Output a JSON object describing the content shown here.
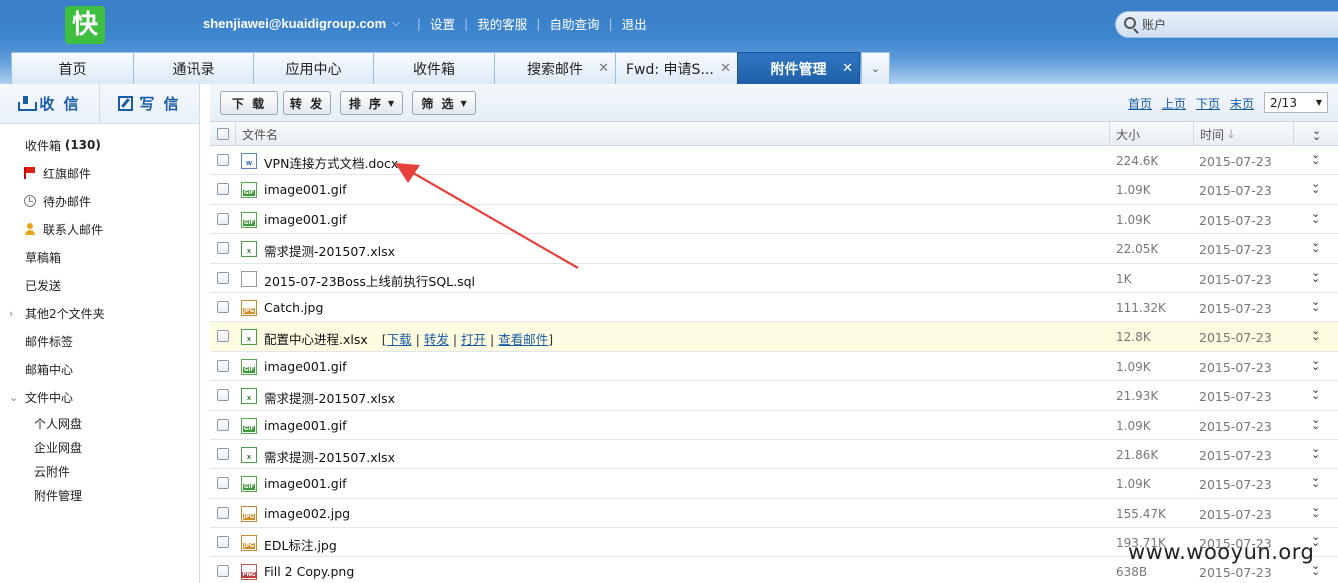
{
  "header": {
    "logo_text": "快",
    "user_email": "shenjiawei@kuaidigroup.com",
    "links": [
      "设置",
      "我的客服",
      "自助查询",
      "退出"
    ],
    "search_placeholder": "账户"
  },
  "tabs": [
    {
      "label": "首页",
      "closable": false
    },
    {
      "label": "通讯录",
      "closable": false
    },
    {
      "label": "应用中心",
      "closable": false
    },
    {
      "label": "收件箱",
      "closable": false
    },
    {
      "label": "搜索邮件",
      "closable": true
    },
    {
      "label": "Fwd: 申请S...",
      "closable": true
    },
    {
      "label": "附件管理",
      "closable": true,
      "active": true
    }
  ],
  "sidebar": {
    "receive_label": "收 信",
    "write_label": "写 信",
    "inbox_label": "收件箱",
    "inbox_count": "(130)",
    "items": [
      "红旗邮件",
      "待办邮件",
      "联系人邮件",
      "草稿箱",
      "已发送",
      "其他2个文件夹",
      "邮件标签",
      "邮箱中心",
      "文件中心"
    ],
    "file_center_items": [
      "个人网盘",
      "企业网盘",
      "云附件",
      "附件管理"
    ]
  },
  "toolbar": {
    "download": "下 载",
    "forward": "转 发",
    "sort": "排 序",
    "filter": "筛 选",
    "pager": {
      "first": "首页",
      "prev": "上页",
      "next": "下页",
      "last": "末页",
      "current": "2/13"
    }
  },
  "table": {
    "columns": {
      "name": "文件名",
      "size": "大小",
      "time": "时间"
    },
    "rows": [
      {
        "type": "word",
        "name": "VPN连接方式文档.docx",
        "size": "224.6K",
        "date": "2015-07-23"
      },
      {
        "type": "gif",
        "name": "image001.gif",
        "size": "1.09K",
        "date": "2015-07-23"
      },
      {
        "type": "gif",
        "name": "image001.gif",
        "size": "1.09K",
        "date": "2015-07-23"
      },
      {
        "type": "xlsx",
        "name": "需求提测-201507.xlsx",
        "size": "22.05K",
        "date": "2015-07-23"
      },
      {
        "type": "sql",
        "name": "2015-07-23Boss上线前执行SQL.sql",
        "size": "1K",
        "date": "2015-07-23"
      },
      {
        "type": "jpg",
        "name": "Catch.jpg",
        "size": "111.32K",
        "date": "2015-07-23"
      },
      {
        "type": "xlsx",
        "name": "配置中心进程.xlsx",
        "size": "12.8K",
        "date": "2015-07-23",
        "hover": true
      },
      {
        "type": "gif",
        "name": "image001.gif",
        "size": "1.09K",
        "date": "2015-07-23"
      },
      {
        "type": "xlsx",
        "name": "需求提测-201507.xlsx",
        "size": "21.93K",
        "date": "2015-07-23"
      },
      {
        "type": "gif",
        "name": "image001.gif",
        "size": "1.09K",
        "date": "2015-07-23"
      },
      {
        "type": "xlsx",
        "name": "需求提测-201507.xlsx",
        "size": "21.86K",
        "date": "2015-07-23"
      },
      {
        "type": "gif",
        "name": "image001.gif",
        "size": "1.09K",
        "date": "2015-07-23"
      },
      {
        "type": "jpg",
        "name": "image002.jpg",
        "size": "155.47K",
        "date": "2015-07-23"
      },
      {
        "type": "jpg",
        "name": "EDL标注.jpg",
        "size": "193.71K",
        "date": "2015-07-23"
      },
      {
        "type": "png",
        "name": "Fill 2 Copy.png",
        "size": "638B",
        "date": "2015-07-23"
      }
    ],
    "row_actions": {
      "download": "下载",
      "forward": "转发",
      "open": "打开",
      "view_mail": "查看邮件"
    }
  },
  "watermark": "www.wooyun.org",
  "colors": {
    "header": "#3d86cf",
    "active_tab": "#1f5fa8",
    "link": "#1a5ca6",
    "annotation": "#e8413c",
    "hover_row": "#fdfbe0"
  }
}
